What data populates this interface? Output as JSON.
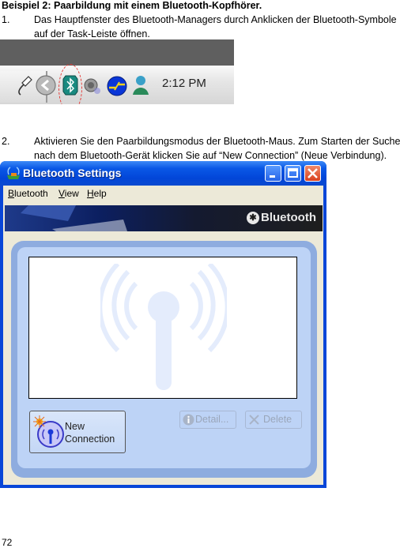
{
  "heading": "Beispiel 2: Paarbildung mit einem Bluetooth-Kopfhörer.",
  "steps": [
    {
      "num": "1.",
      "line1": "Das Hauptfenster des Bluetooth-Managers durch Anklicken der Bluetooth-Symbole",
      "line2": "auf der Task-Leiste öffnen."
    },
    {
      "num": "2.",
      "line1": "Aktivieren Sie den Paarbildungsmodus der Bluetooth-Maus. Zum Starten der Suche",
      "line2": "nach dem Bluetooth-Gerät klicken Sie auf “New Connection” (Neue Verbindung)."
    }
  ],
  "taskbar": {
    "clock": "2:12 PM",
    "icons": [
      "usb-plug-icon",
      "collapse-arrow-icon",
      "bluetooth-tray-icon",
      "speaker-icon",
      "network-icon",
      "messenger-icon"
    ],
    "highlight_color": "#e53935"
  },
  "window": {
    "title": "Bluetooth Settings",
    "menu": [
      {
        "label": "Bluetooth",
        "accel": "B",
        "rest": "luetooth"
      },
      {
        "label": "View",
        "accel": "V",
        "rest": "iew"
      },
      {
        "label": "Help",
        "accel": "H",
        "rest": "elp"
      }
    ],
    "banner_logo": "Bluetooth",
    "buttons": {
      "new_connection_line1": "New",
      "new_connection_line2": "Connection",
      "detail": "Detail...",
      "delete": "Delete"
    },
    "colors": {
      "titlebar": "#0846d8",
      "panel": "#bdd3f6",
      "panel_border": "#8eacdf"
    }
  },
  "page_number": "72"
}
